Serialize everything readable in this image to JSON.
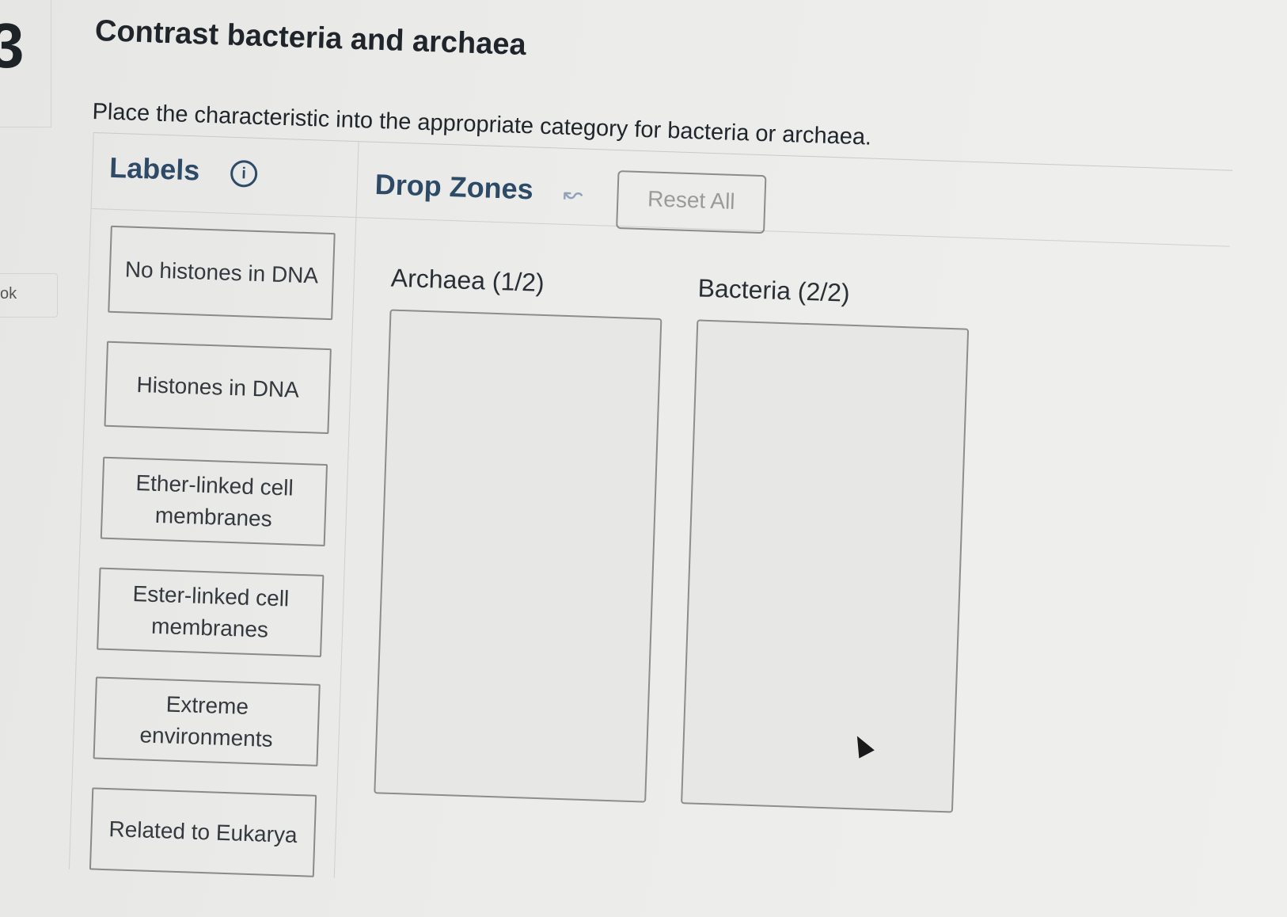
{
  "question": {
    "number": "3",
    "title": "Contrast bacteria and archaea",
    "instructions": "Place the characteristic into the appropriate category for bacteria or archaea."
  },
  "sidebar": {
    "tab_label": "ok"
  },
  "labels_panel": {
    "heading": "Labels",
    "info_icon": "i",
    "items": [
      {
        "label": "No histones in DNA"
      },
      {
        "label": "Histones in DNA"
      },
      {
        "label": "Ether-linked cell membranes"
      },
      {
        "label": "Ester-linked cell membranes"
      },
      {
        "label": "Extreme environments"
      },
      {
        "label": "Related to Eukarya"
      }
    ]
  },
  "drop_zones_panel": {
    "heading": "Drop Zones",
    "undo_icon": "↜",
    "reset_label": "Reset All",
    "zones": [
      {
        "title": "Archaea (1/2)"
      },
      {
        "title": "Bacteria (2/2)"
      }
    ]
  }
}
